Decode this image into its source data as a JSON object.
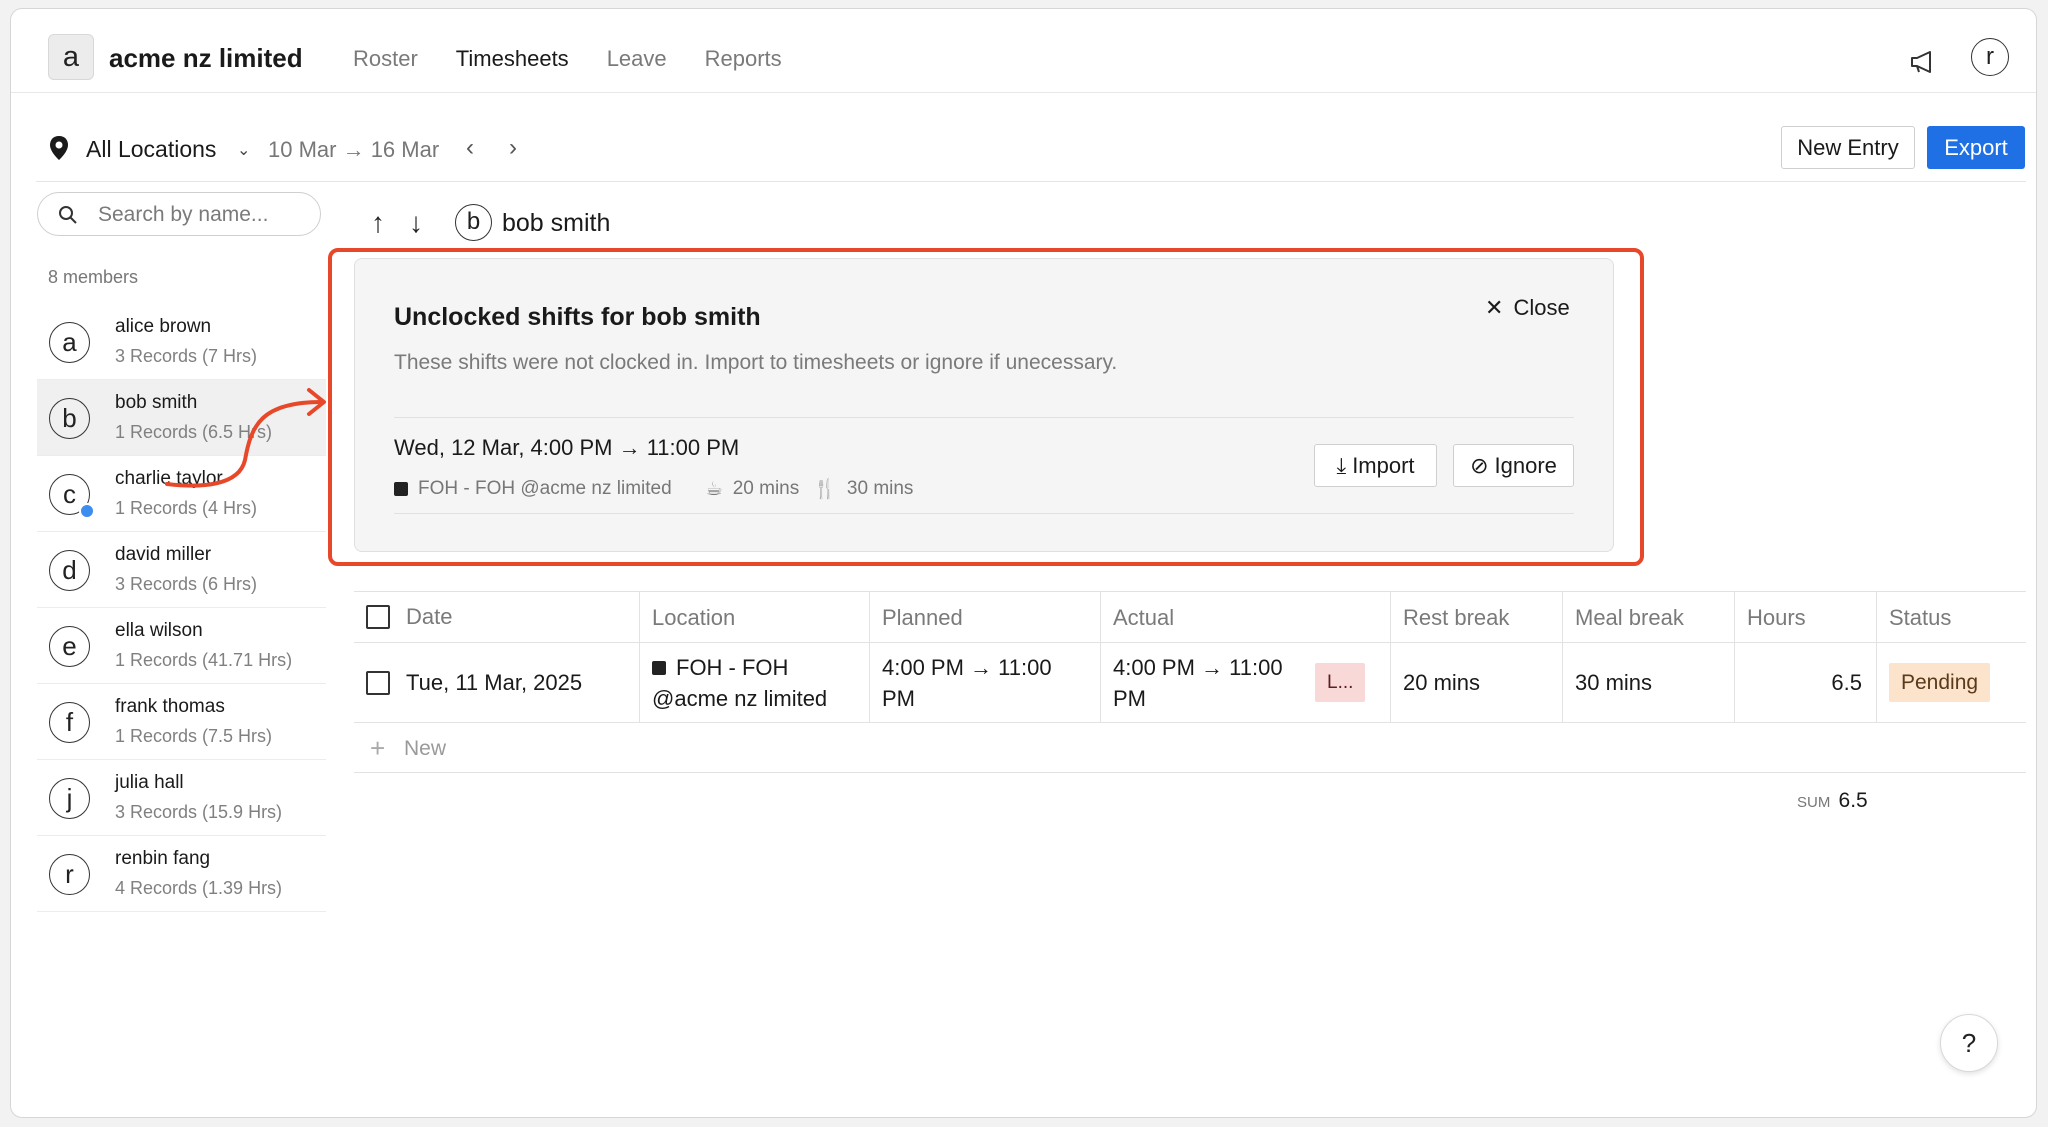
{
  "org": {
    "badge": "a",
    "name": "acme nz limited"
  },
  "nav": {
    "items": [
      "Roster",
      "Timesheets",
      "Leave",
      "Reports"
    ],
    "active": "Timesheets"
  },
  "user_avatar": "r",
  "toolbar": {
    "location": "All Locations",
    "date_range": "10 Mar → 16 Mar",
    "prev": "‹",
    "next": "›",
    "new_entry": "New Entry",
    "export": "Export",
    "export_color": "#1f6fe5"
  },
  "sidebar": {
    "search_placeholder": "Search by name...",
    "member_count": "8 members",
    "members": [
      {
        "initial": "a",
        "name": "alice brown",
        "sub": "3 Records (7 Hrs)"
      },
      {
        "initial": "b",
        "name": "bob smith",
        "sub": "1 Records (6.5 Hrs)"
      },
      {
        "initial": "c",
        "name": "charlie taylor",
        "sub": "1 Records (4 Hrs)"
      },
      {
        "initial": "d",
        "name": "david miller",
        "sub": "3 Records (6 Hrs)"
      },
      {
        "initial": "e",
        "name": "ella wilson",
        "sub": "1 Records (41.71 Hrs)"
      },
      {
        "initial": "f",
        "name": "frank thomas",
        "sub": "1 Records (7.5 Hrs)"
      },
      {
        "initial": "j",
        "name": "julia hall",
        "sub": "3 Records (15.9 Hrs)"
      },
      {
        "initial": "r",
        "name": "renbin fang",
        "sub": "4 Records (1.39 Hrs)"
      }
    ]
  },
  "main": {
    "selected_initial": "b",
    "selected_name": "bob smith"
  },
  "panel": {
    "title": "Unclocked shifts for bob smith",
    "description": "These shifts were not clocked in. Import to timesheets or ignore if unecessary.",
    "close": "Close",
    "shift_time": "Wed, 12 Mar, 4:00 PM → 11:00 PM",
    "location": "FOH - FOH @acme nz limited",
    "rest": "20 mins",
    "meal": "30 mins",
    "import": "Import",
    "ignore": "Ignore",
    "highlight_color": "#e8482a"
  },
  "table": {
    "headers": [
      "Date",
      "Location",
      "Planned",
      "Actual",
      "Rest break",
      "Meal break",
      "Hours",
      "Status"
    ],
    "row": {
      "date": "Tue, 11 Mar, 2025",
      "location": "FOH - FOH @acme nz limited",
      "planned": "4:00 PM → 11:00 PM",
      "actual": "4:00 PM → 11:00 PM",
      "actual_chip": "L...",
      "rest": "20 mins",
      "meal": "30 mins",
      "hours": "6.5",
      "status": "Pending"
    },
    "new_label": "New",
    "sum_label": "SUM",
    "sum_value": "6.5"
  },
  "help": "?"
}
